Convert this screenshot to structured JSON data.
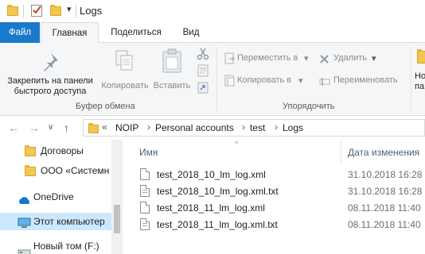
{
  "titlebar": {
    "title": "Logs",
    "dropdown_glyph": "▾",
    "icons": [
      "folder-icon",
      "properties-checkbox-icon",
      "new-folder-icon",
      "customize-dropdown-icon"
    ]
  },
  "tabs": {
    "file": "Файл",
    "home": "Главная",
    "share": "Поделиться",
    "view": "Вид"
  },
  "ribbon": {
    "pin": "Закрепить на панели быстрого доступа",
    "pin_line1": "Закрепить на панели",
    "pin_line2": "быстрого доступа",
    "copy": "Копировать",
    "paste": "Вставить",
    "clipboard_group": "Буфер обмена",
    "move_to": "Переместить в",
    "copy_to": "Копировать в",
    "delete": "Удалить",
    "rename": "Переименовать",
    "organize_group": "Упорядочить",
    "new_partial": "Но",
    "new_partial2": "па",
    "dropdown_glyph": "▾"
  },
  "address": {
    "back": "←",
    "forward": "→",
    "recent": "∨",
    "up": "↑",
    "overflow": "«",
    "separator": "›",
    "crumbs": [
      "NOIP",
      "Personal accounts",
      "test",
      "Logs"
    ]
  },
  "navpane": {
    "items": [
      {
        "label": "Договоры",
        "icon": "folder-icon"
      },
      {
        "label": "ООО «Системн",
        "icon": "folder-icon"
      },
      {
        "label": "OneDrive",
        "icon": "onedrive-icon"
      },
      {
        "label": "Этот компьютер",
        "icon": "computer-icon"
      },
      {
        "label": "Новый том (F:)",
        "icon": "drive-icon"
      }
    ]
  },
  "filelist": {
    "col_name": "Имя",
    "col_date": "Дата изменения",
    "sort_glyph": "^",
    "files": [
      {
        "name": "test_2018_10_lm_log.xml",
        "date": "31.10.2018 16:28",
        "icon": "xml-file-icon"
      },
      {
        "name": "test_2018_10_lm_log.xml.txt",
        "date": "31.10.2018 16:28",
        "icon": "text-file-icon"
      },
      {
        "name": "test_2018_11_lm_log.xml",
        "date": "08.11.2018 11:40",
        "icon": "xml-file-icon"
      },
      {
        "name": "test_2018_11_lm_log.xml.txt",
        "date": "08.11.2018 11:40",
        "icon": "text-file-icon"
      }
    ]
  },
  "colors": {
    "accent": "#1979ca",
    "selection": "#cce8ff",
    "folder": "#f3c64d",
    "disabled_text": "#8a8a8a"
  }
}
